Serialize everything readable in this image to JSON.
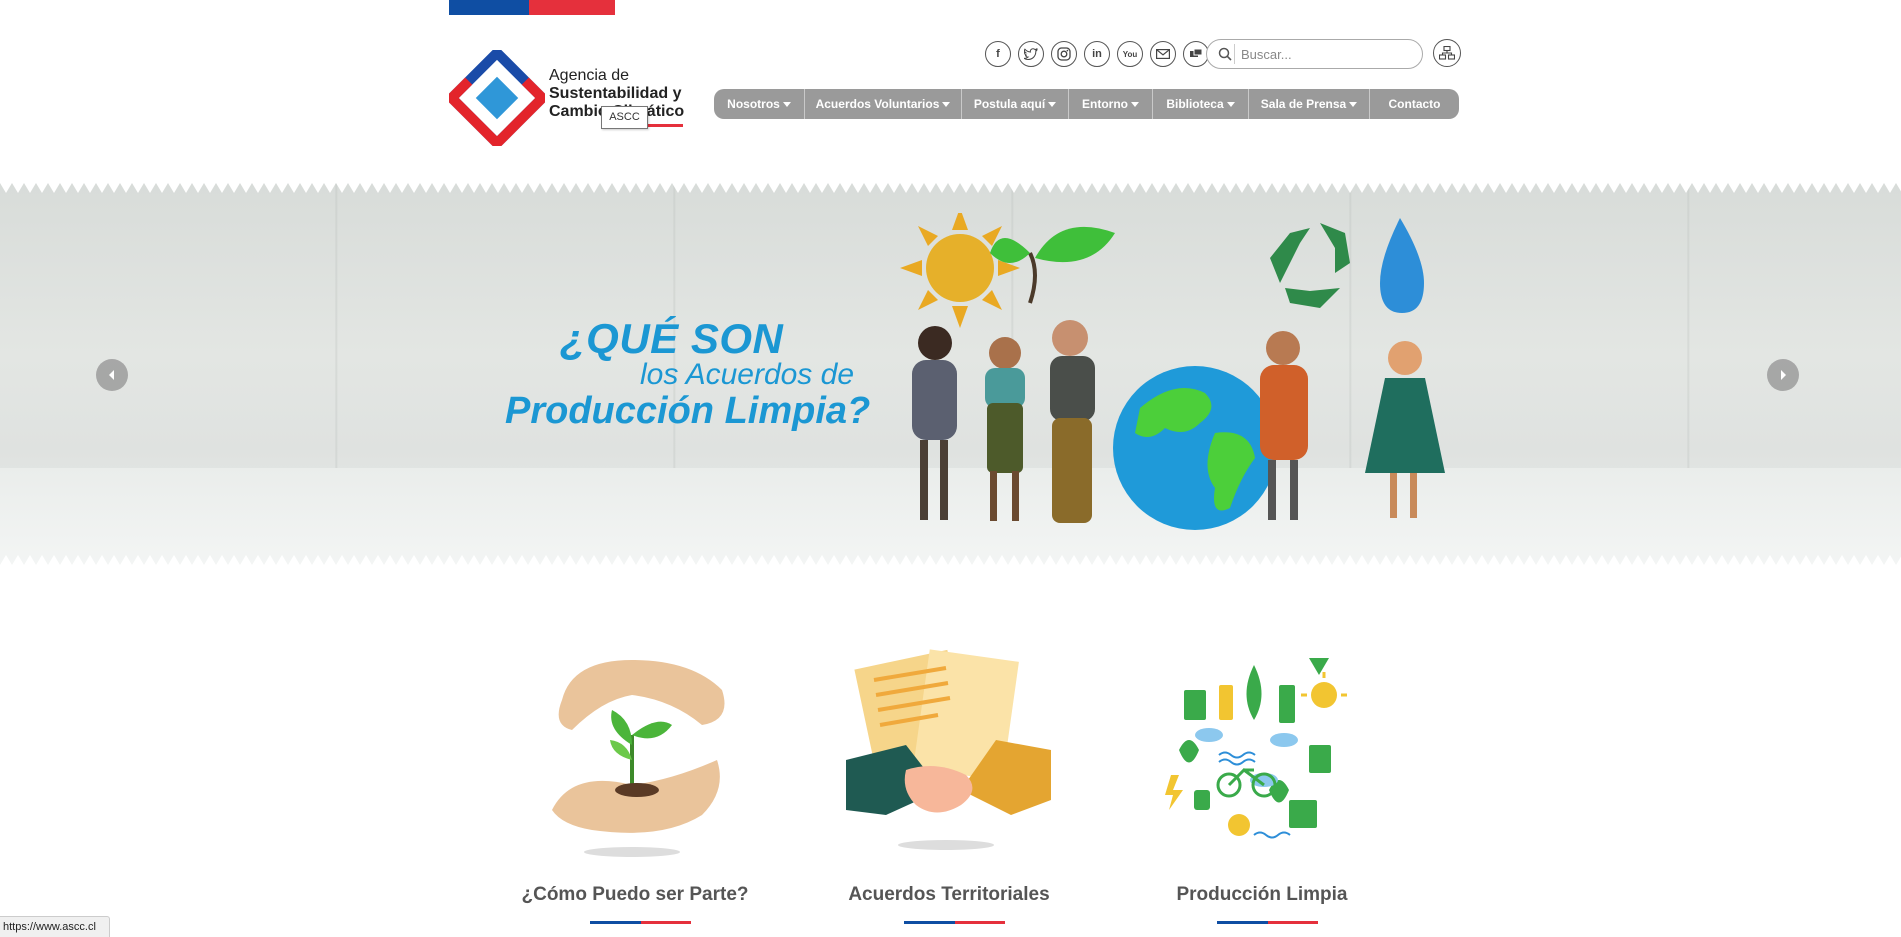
{
  "header": {
    "logo": {
      "line1": "Agencia de",
      "line2": "Sustentabilidad y",
      "line3": "Cambio Climático",
      "tooltip": "ASCC"
    },
    "social_icons": [
      {
        "icon": "facebook-icon",
        "glyph": "f"
      },
      {
        "icon": "twitter-icon",
        "glyph": "t"
      },
      {
        "icon": "instagram-icon",
        "glyph": "◎"
      },
      {
        "icon": "linkedin-icon",
        "glyph": "in"
      },
      {
        "icon": "youtube-icon",
        "glyph": "You"
      },
      {
        "icon": "email-icon",
        "glyph": "✉"
      },
      {
        "icon": "flickr-icon",
        "glyph": "▣"
      }
    ],
    "search": {
      "placeholder": "Buscar..."
    },
    "sitemap_icon": "sitemap-icon"
  },
  "nav": {
    "items": [
      {
        "label": "Nosotros",
        "dropdown": true
      },
      {
        "label": "Acuerdos Voluntarios",
        "dropdown": true
      },
      {
        "label": "Postula aquí",
        "dropdown": true
      },
      {
        "label": "Entorno",
        "dropdown": true
      },
      {
        "label": "Biblioteca",
        "dropdown": true
      },
      {
        "label": "Sala de Prensa",
        "dropdown": true
      },
      {
        "label": "Contacto",
        "dropdown": false
      }
    ]
  },
  "hero": {
    "title_line1": "¿QUÉ SON",
    "title_line2": "los Acuerdos de",
    "title_line3": "Producción Limpia?"
  },
  "cards": [
    {
      "title": "¿Cómo Puedo ser Parte?",
      "icon": "hands-plant-icon"
    },
    {
      "title": "Acuerdos Territoriales",
      "icon": "handshake-documents-icon"
    },
    {
      "title": "Producción Limpia",
      "icon": "eco-energy-icon"
    }
  ],
  "status": {
    "url": "https://www.ascc.cl"
  },
  "colors": {
    "gov_blue": "#0f4ea3",
    "gov_red": "#e5303c",
    "nav_gray": "#9a9a9a",
    "hero_blue": "#1b97d3",
    "card_title": "#555555"
  }
}
